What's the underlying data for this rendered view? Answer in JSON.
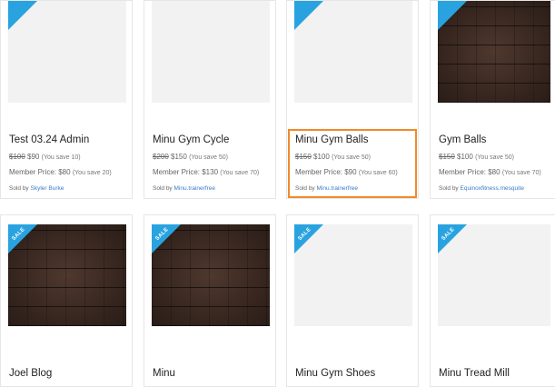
{
  "ribbon_label": "SALE",
  "colors": {
    "ribbon": "#29a3e0",
    "highlight_border": "#f08a2a",
    "seller_link": "#3a7bc8"
  },
  "products": [
    {
      "title": "Test 03.24 Admin",
      "old_price": "$100",
      "price": "$90",
      "save": "(You save 10)",
      "member_label": "Member Price: $80",
      "member_save": "(You save 20)",
      "sold_by": "Sold by",
      "seller": "Skyler Burke"
    },
    {
      "title": "Minu Gym Cycle",
      "old_price": "$200",
      "price": "$150",
      "save": "(You save 50)",
      "member_label": "Member Price: $130",
      "member_save": "(You save 70)",
      "sold_by": "Sold by",
      "seller": "Minu.trainerfree"
    },
    {
      "title": "Minu Gym Balls",
      "old_price": "$150",
      "price": "$100",
      "save": "(You save 50)",
      "member_label": "Member Price: $90",
      "member_save": "(You save 60)",
      "sold_by": "Sold by",
      "seller": "Minu.trainerfree"
    },
    {
      "title": "Gym Balls",
      "old_price": "$150",
      "price": "$100",
      "save": "(You save 50)",
      "member_label": "Member Price: $80",
      "member_save": "(You save 70)",
      "sold_by": "Sold by",
      "seller": "Equinoxfitness.mesquite"
    },
    {
      "title": "Joel Blog"
    },
    {
      "title": "Minu"
    },
    {
      "title": "Minu Gym Shoes"
    },
    {
      "title": "Minu Tread Mill"
    }
  ]
}
